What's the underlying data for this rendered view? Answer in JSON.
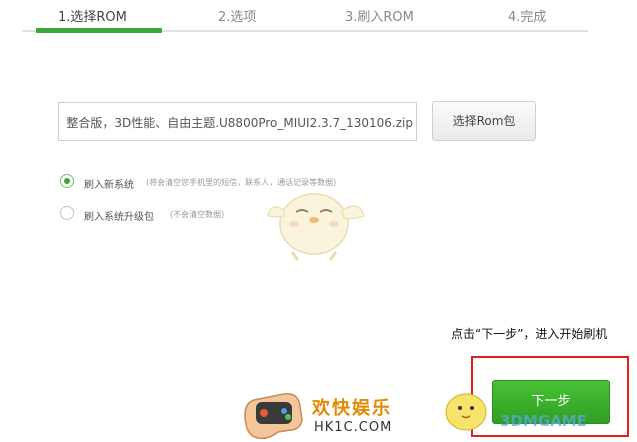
{
  "steps": {
    "items": [
      {
        "label": "1.选择ROM"
      },
      {
        "label": "2.选项"
      },
      {
        "label": "3.刷入ROM"
      },
      {
        "label": "4.完成"
      }
    ],
    "active_index": 0,
    "accent_color": "#3ba63a"
  },
  "file": {
    "value": "整合版，3D性能、自由主题.U8800Pro_MIUI2.3.7_130106.zip",
    "button_label": "选择Rom包"
  },
  "options": [
    {
      "label": "刷入新系统",
      "note": "(将会清空您手机里的短信，联系人，通话记录等数据)",
      "selected": true
    },
    {
      "label": "刷入系统升级包",
      "note": "(不会清空数据)",
      "selected": false
    }
  ],
  "hint": {
    "text": "点击“下一步”，进入开始刷机"
  },
  "next_button": {
    "label": "下一步"
  },
  "logo": {
    "cn": "欢快娱乐",
    "en": "HK1C.COM"
  },
  "watermark": {
    "text": "3DMGAME"
  }
}
